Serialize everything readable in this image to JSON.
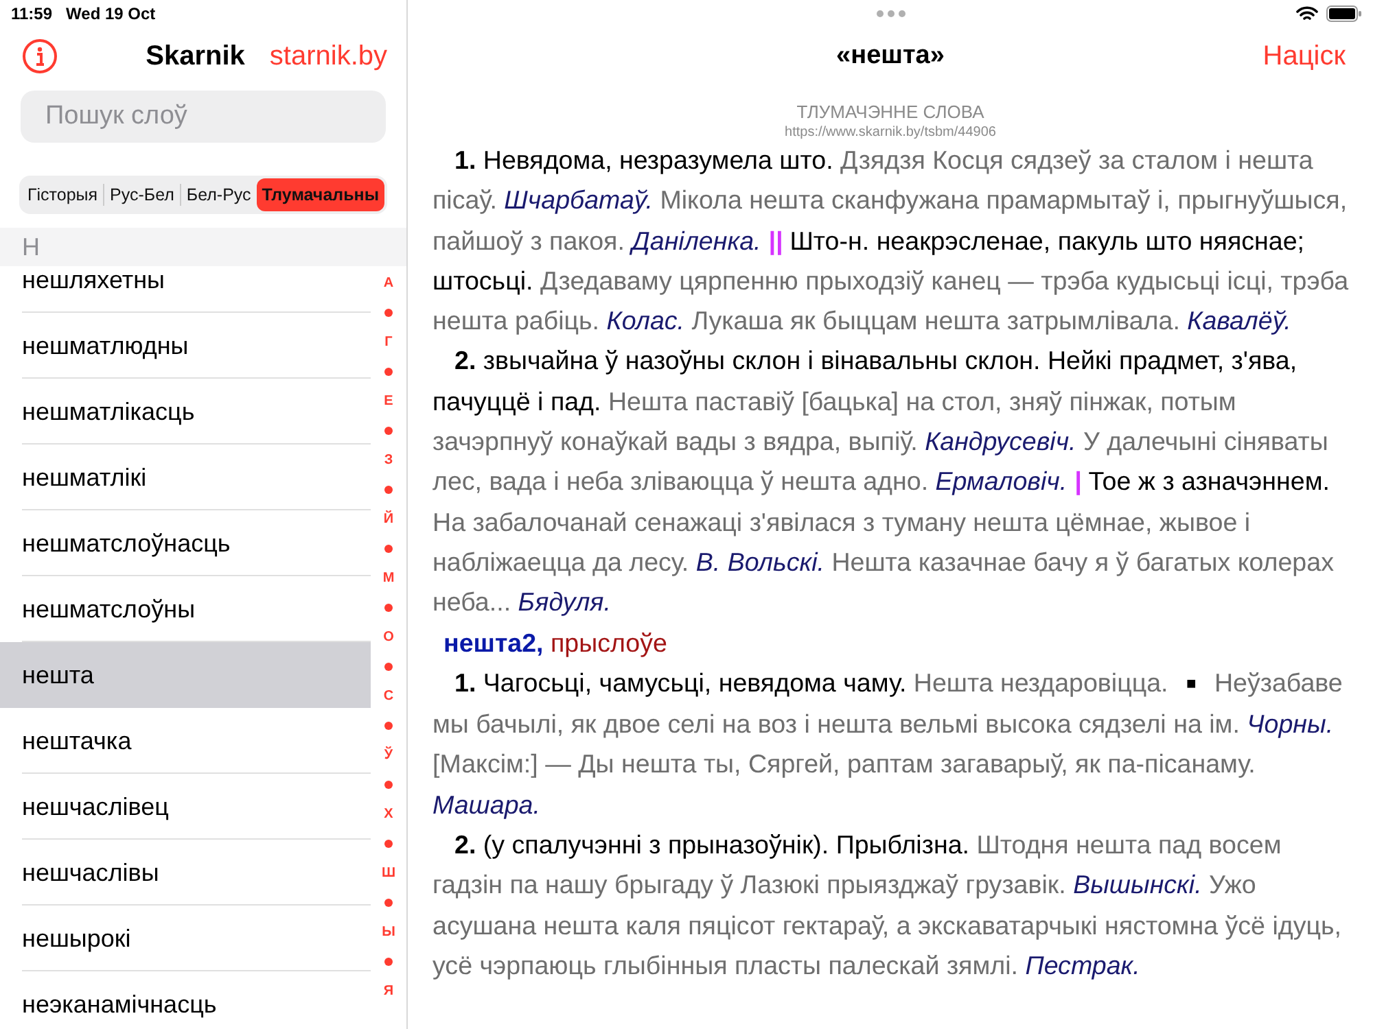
{
  "status_bar": {
    "time": "11:59",
    "date": "Wed 19 Oct"
  },
  "sidebar": {
    "title": "Skarnik",
    "link": "starnik.by",
    "search": {
      "placeholder": "Пошук слоў"
    },
    "segments": [
      {
        "label": "Гісторыя",
        "selected": false
      },
      {
        "label": "Рус-Бел",
        "selected": false
      },
      {
        "label": "Бел-Рус",
        "selected": false
      },
      {
        "label": "Тлумачальны",
        "selected": true
      }
    ],
    "section": "Н",
    "words": [
      {
        "label": "нешляхетны",
        "selected": false
      },
      {
        "label": "нешматлюдны",
        "selected": false
      },
      {
        "label": "нешматлікасць",
        "selected": false
      },
      {
        "label": "нешматлікі",
        "selected": false
      },
      {
        "label": "нешматслоўнасць",
        "selected": false
      },
      {
        "label": "нешматслоўны",
        "selected": false
      },
      {
        "label": "нешта",
        "selected": true
      },
      {
        "label": "нештачка",
        "selected": false
      },
      {
        "label": "нешчаслівец",
        "selected": false
      },
      {
        "label": "нешчаслівы",
        "selected": false
      },
      {
        "label": "нешырокі",
        "selected": false
      },
      {
        "label": "неэканамічнасць",
        "selected": false
      }
    ],
    "index": [
      "А",
      "Г",
      "Е",
      "З",
      "Й",
      "М",
      "О",
      "С",
      "Ў",
      "Х",
      "Ш",
      "Ы",
      "Я"
    ]
  },
  "detail": {
    "title": "«нешта»",
    "action": "Націск",
    "subtitle": "ТЛУМАЧЭННЕ СЛОВА",
    "url": "https://www.skarnik.by/tsbm/44906",
    "paragraphs": [
      {
        "kind": "sense",
        "segments": [
          {
            "kind": "num",
            "text": "1."
          },
          {
            "kind": "def",
            "text": "Невядома, незразумела што."
          },
          {
            "kind": "example",
            "text": "Дзядзя Косця сядзеў за сталом і нешта пісаў."
          },
          {
            "kind": "author",
            "text": "Шчарбатаў."
          },
          {
            "kind": "example",
            "text": "Мікола нешта сканфужана прамармытаў і, прыгнуўшыся, пайшоў з пакоя."
          },
          {
            "kind": "author",
            "text": "Даніленка."
          },
          {
            "kind": "sep",
            "text": "||"
          },
          {
            "kind": "def",
            "text": "Што-н. неакрэсленае, пакуль што няяснае; штосьці."
          },
          {
            "kind": "example",
            "text": "Дзедаваму цярпенню прыходзіў канец — трэба кудысьці ісці, трэба нешта рабіць."
          },
          {
            "kind": "author",
            "text": "Колас."
          },
          {
            "kind": "example",
            "text": "Лукаша як быццам нешта затрымлівала."
          },
          {
            "kind": "author",
            "text": "Кавалёў."
          }
        ]
      },
      {
        "kind": "sense",
        "segments": [
          {
            "kind": "num",
            "text": "2."
          },
          {
            "kind": "def",
            "text": "звычайна ў назоўны склон і вінавальны склон. Нейкі прадмет, з'ява, пачуццё і пад."
          },
          {
            "kind": "example",
            "text": "Нешта паставіў [бацька] на стол, зняў пінжак, потым зачэрпнуў конаўкай вады з вядра, выпіў."
          },
          {
            "kind": "author",
            "text": "Кандрусевіч."
          },
          {
            "kind": "example",
            "text": "У далечыні сіняваты лес, вада і неба зліваюцца ў нешта адно."
          },
          {
            "kind": "author",
            "text": "Ермаловіч."
          },
          {
            "kind": "sep",
            "text": "|"
          },
          {
            "kind": "def",
            "text": "Тое ж з азначэннем."
          },
          {
            "kind": "example",
            "text": "На забалочанай сенажаці з'явілася з туману нешта цёмнае, жывое і набліжаецца да лесу."
          },
          {
            "kind": "author",
            "text": "В. Вольскі."
          },
          {
            "kind": "example",
            "text": "Нешта казачнае бачу я ў багатых колерах неба..."
          },
          {
            "kind": "author",
            "text": "Бядуля."
          }
        ]
      },
      {
        "kind": "head",
        "segments": [
          {
            "kind": "headword",
            "text": "нешта2,"
          },
          {
            "kind": "pos",
            "text": "прыслоўе"
          }
        ]
      },
      {
        "kind": "sense",
        "segments": [
          {
            "kind": "num",
            "text": "1."
          },
          {
            "kind": "def",
            "text": "Чагосьці, чамусьці, невядома чаму."
          },
          {
            "kind": "example",
            "text": "Нешта нездаровіцца."
          },
          {
            "kind": "mark",
            "text": "■"
          },
          {
            "kind": "example",
            "text": "Неўзабаве мы бачылі, як двое селі на воз і нешта вельмі высока сядзелі на ім."
          },
          {
            "kind": "author",
            "text": "Чорны."
          },
          {
            "kind": "example",
            "text": "[Максім:] — Ды нешта ты, Сяргей, раптам загаварыў, як па-пісанаму."
          },
          {
            "kind": "author",
            "text": "Машара."
          }
        ]
      },
      {
        "kind": "sense",
        "segments": [
          {
            "kind": "num",
            "text": "2."
          },
          {
            "kind": "def",
            "text": "(у спалучэнні з прыназоўнік). Прыблізна."
          },
          {
            "kind": "example",
            "text": "Штодня нешта пад восем гадзін па нашу брыгаду ў Лазюкі прыязджаў грузавік."
          },
          {
            "kind": "author",
            "text": "Вышынскі."
          },
          {
            "kind": "example",
            "text": "Ужо асушана нешта каля пяцісот гектараў, а экскаватарчыкі нястомна ўсё ідуць, усё чэрпаюць глыбінныя пласты палескай зямлі."
          },
          {
            "kind": "author",
            "text": "Пестрак."
          }
        ]
      }
    ]
  }
}
